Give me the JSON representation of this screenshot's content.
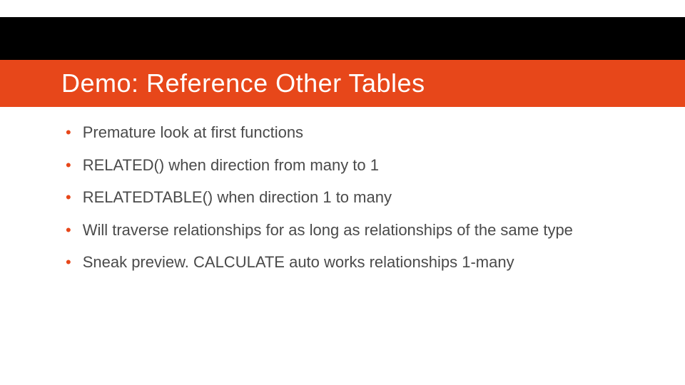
{
  "title": "Demo: Reference Other Tables",
  "bullets": [
    {
      "text": "Premature look at first functions"
    },
    {
      "text": "RELATED() when direction from many to 1"
    },
    {
      "text": "RELATEDTABLE() when direction 1 to many"
    },
    {
      "text": "Will traverse relationships for as long as relationships of the same type"
    },
    {
      "text": "Sneak preview.   CALCULATE auto works relationships 1-many"
    }
  ],
  "colors": {
    "accent": "#e7471a",
    "band_top": "#000000",
    "text": "#4a4a4a"
  }
}
